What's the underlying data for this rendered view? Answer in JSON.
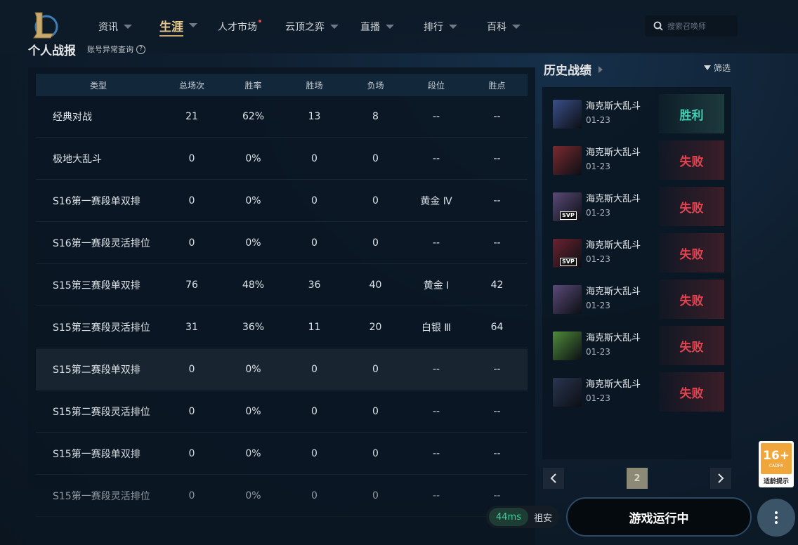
{
  "nav": {
    "items": [
      {
        "label": "资讯",
        "has_caret": true
      },
      {
        "label": "生涯",
        "has_caret": true,
        "active": true
      },
      {
        "label": "人才市场",
        "has_dot": true
      },
      {
        "label": "云顶之弈",
        "has_caret": true
      },
      {
        "label": "直播",
        "has_caret": true
      },
      {
        "label": "排行",
        "has_caret": true
      },
      {
        "label": "百科",
        "has_caret": true
      }
    ],
    "search_placeholder": "搜索召唤师"
  },
  "stats": {
    "title": "个人战报",
    "subtitle": "账号异常查询",
    "headers": [
      "类型",
      "总场次",
      "胜率",
      "胜场",
      "负场",
      "段位",
      "胜点"
    ],
    "rows": [
      [
        "经典对战",
        "21",
        "62%",
        "13",
        "8",
        "--",
        "--"
      ],
      [
        "极地大乱斗",
        "0",
        "0%",
        "0",
        "0",
        "--",
        "--"
      ],
      [
        "S16第一赛段单双排",
        "0",
        "0%",
        "0",
        "0",
        "黄金 Ⅳ",
        "--"
      ],
      [
        "S16第一赛段灵活排位",
        "0",
        "0%",
        "0",
        "0",
        "--",
        "--"
      ],
      [
        "S15第三赛段单双排",
        "76",
        "48%",
        "36",
        "40",
        "黄金 Ⅰ",
        "42"
      ],
      [
        "S15第三赛段灵活排位",
        "31",
        "36%",
        "11",
        "20",
        "白银 Ⅲ",
        "64"
      ],
      [
        "S15第二赛段单双排",
        "0",
        "0%",
        "0",
        "0",
        "--",
        "--"
      ],
      [
        "S15第二赛段灵活排位",
        "0",
        "0%",
        "0",
        "0",
        "--",
        "--"
      ],
      [
        "S15第一赛段单双排",
        "0",
        "0%",
        "0",
        "0",
        "--",
        "--"
      ],
      [
        "S15第一赛段灵活排位",
        "0",
        "0%",
        "0",
        "0",
        "--",
        "--"
      ]
    ]
  },
  "history": {
    "title": "历史战绩",
    "filter_label": "筛选",
    "matches": [
      {
        "mode": "海克斯大乱斗",
        "date": "01-23",
        "result": "胜利",
        "win": true,
        "svp": false,
        "avatar_color": "#3a4f8a"
      },
      {
        "mode": "海克斯大乱斗",
        "date": "01-23",
        "result": "失败",
        "win": false,
        "svp": false,
        "avatar_color": "#7a2a30"
      },
      {
        "mode": "海克斯大乱斗",
        "date": "01-23",
        "result": "失败",
        "win": false,
        "svp": true,
        "avatar_color": "#5a4a78"
      },
      {
        "mode": "海克斯大乱斗",
        "date": "01-23",
        "result": "失败",
        "win": false,
        "svp": true,
        "avatar_color": "#6a2230"
      },
      {
        "mode": "海克斯大乱斗",
        "date": "01-23",
        "result": "失败",
        "win": false,
        "svp": false,
        "avatar_color": "#5a4a78"
      },
      {
        "mode": "海克斯大乱斗",
        "date": "01-23",
        "result": "失败",
        "win": false,
        "svp": false,
        "avatar_color": "#4f8a3a"
      },
      {
        "mode": "海克斯大乱斗",
        "date": "01-23",
        "result": "失败",
        "win": false,
        "svp": false,
        "avatar_color": "#2a3550"
      }
    ],
    "svp_label": "SVP",
    "current_page": "2"
  },
  "bottom": {
    "ping": "44ms",
    "region": "祖安",
    "play_label": "游戏运行中"
  },
  "age_badge": {
    "rating": "16+",
    "org": "CADPA",
    "tip": "适龄提示"
  }
}
